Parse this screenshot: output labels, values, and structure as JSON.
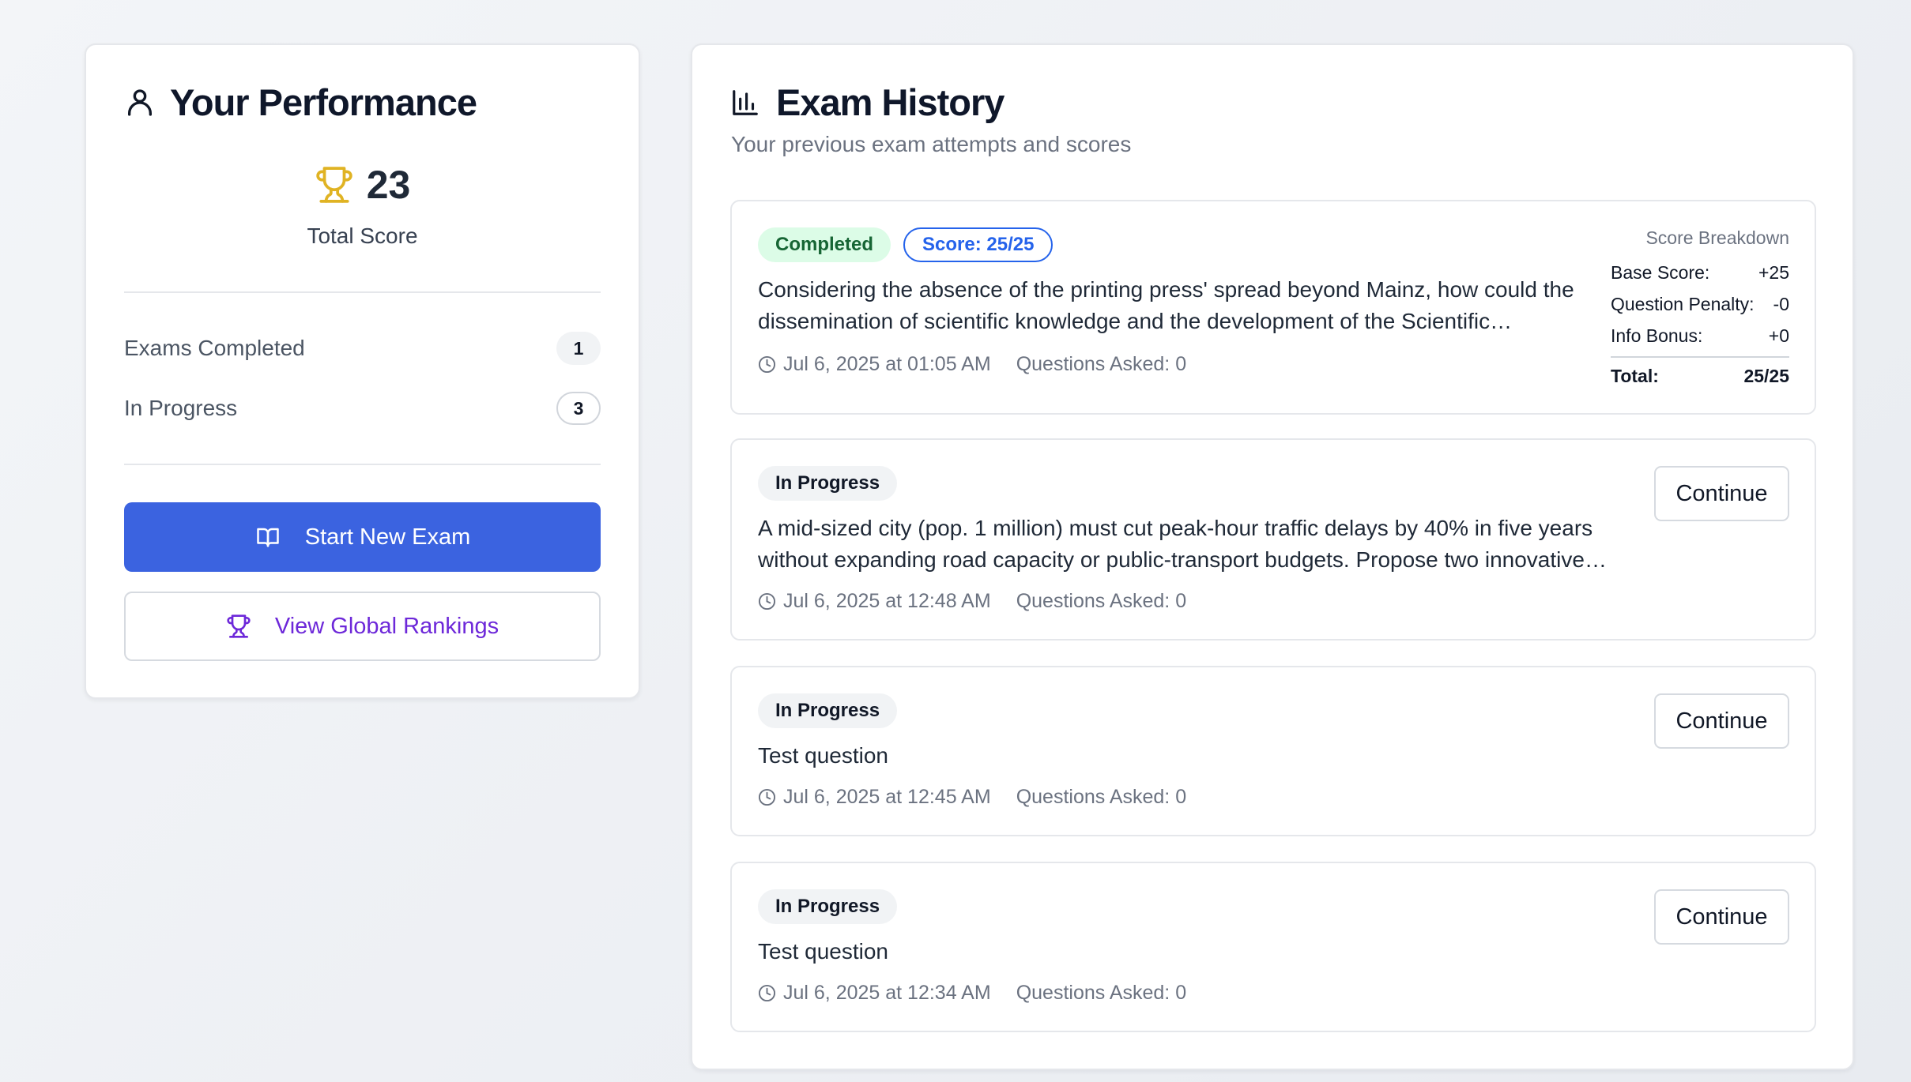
{
  "performance": {
    "title": "Your Performance",
    "total_score": "23",
    "total_score_label": "Total Score",
    "stats": [
      {
        "label": "Exams Completed",
        "value": "1"
      },
      {
        "label": "In Progress",
        "value": "3"
      }
    ],
    "start_button_label": "Start New Exam",
    "rankings_button_label": "View Global Rankings"
  },
  "history": {
    "title": "Exam History",
    "subtitle": "Your previous exam attempts and scores",
    "continue_label": "Continue",
    "exams": [
      {
        "status": "Completed",
        "score_badge": "Score: 25/25",
        "question": "Considering the absence of the printing press' spread beyond Mainz, how could the dissemination of scientific knowledge and the development of the Scientific Revolution have been affected?",
        "date": "Jul 6, 2025 at 01:05 AM",
        "questions_asked": "Questions Asked: 0",
        "breakdown": {
          "title": "Score Breakdown",
          "base_label": "Base Score:",
          "base_value": "+25",
          "penalty_label": "Question Penalty:",
          "penalty_value": "-0",
          "bonus_label": "Info Bonus:",
          "bonus_value": "+0",
          "total_label": "Total:",
          "total_value": "25/25"
        }
      },
      {
        "status": "In Progress",
        "question": "A mid-sized city (pop. 1 million) must cut peak-hour traffic delays by 40% in five years without expanding road capacity or public-transport budgets. Propose two innovative strategies and justify them.",
        "date": "Jul 6, 2025 at 12:48 AM",
        "questions_asked": "Questions Asked: 0"
      },
      {
        "status": "In Progress",
        "question": "Test question",
        "date": "Jul 6, 2025 at 12:45 AM",
        "questions_asked": "Questions Asked: 0"
      },
      {
        "status": "In Progress",
        "question": "Test question",
        "date": "Jul 6, 2025 at 12:34 AM",
        "questions_asked": "Questions Asked: 0"
      }
    ]
  },
  "colors": {
    "primary": "#3b63e0",
    "accent_purple": "#6d28d9",
    "trophy_gold": "#e0b323",
    "completed_bg": "#dcfce7",
    "completed_text": "#166534",
    "score_blue": "#2563eb"
  },
  "icons": {
    "user": "user-icon",
    "trophy": "trophy-icon",
    "book": "book-open-icon",
    "chart": "bar-chart-icon",
    "clock": "clock-icon"
  }
}
